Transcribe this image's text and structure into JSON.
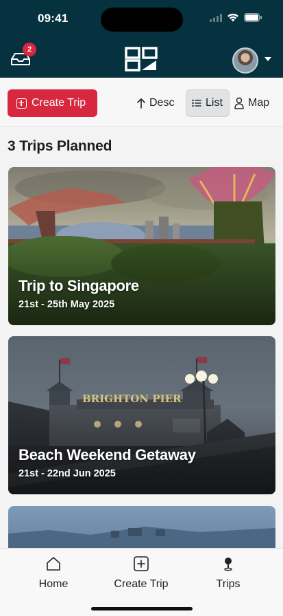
{
  "status": {
    "time": "09:41"
  },
  "header": {
    "inbox_badge": "2"
  },
  "toolbar": {
    "create_label": "Create Trip",
    "sort_label": "Desc",
    "list_label": "List",
    "map_label": "Map"
  },
  "main": {
    "section_title": "3 Trips Planned",
    "trips": [
      {
        "title": "Trip to Singapore",
        "dates": "21st - 25th May 2025"
      },
      {
        "title": "Beach Weekend Getaway",
        "dates": "21st - 22nd Jun 2025"
      }
    ]
  },
  "nav": {
    "home": "Home",
    "create": "Create Trip",
    "trips": "Trips"
  },
  "colors": {
    "header_bg": "#06323f",
    "accent": "#d8283f",
    "badge": "#d8283f"
  }
}
